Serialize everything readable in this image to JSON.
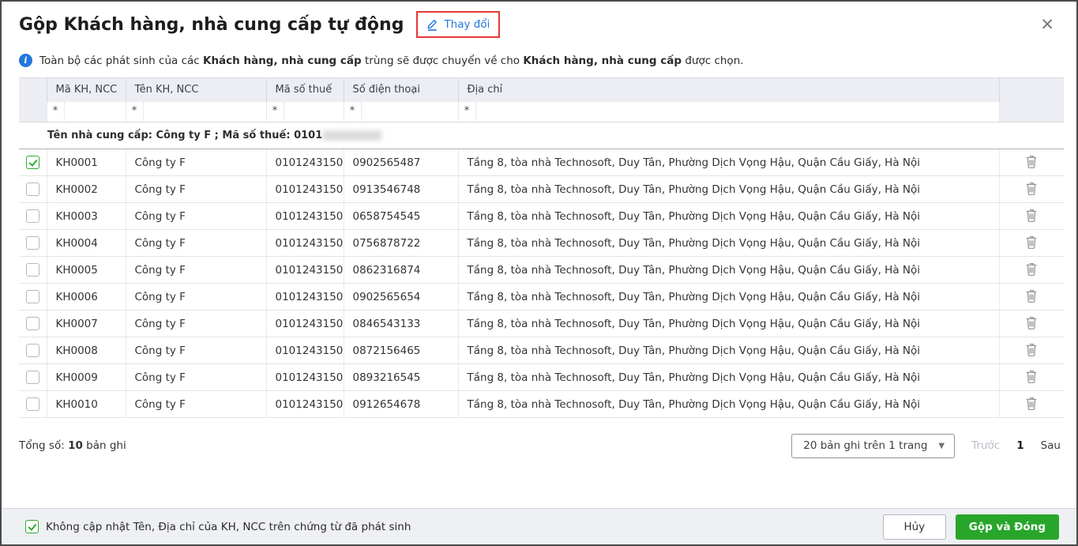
{
  "header": {
    "title": "Gộp Khách hàng, nhà cung cấp tự động",
    "change_button": "Thay đổi",
    "close": "✕"
  },
  "info": {
    "part1": "Toàn bộ các phát sinh của các ",
    "bold1": "Khách hàng, nhà cung cấp",
    "part2": " trùng sẽ được chuyển về cho ",
    "bold2": "Khách hàng, nhà cung cấp",
    "part3": " được chọn."
  },
  "table": {
    "columns": [
      "Mã KH, NCC",
      "Tên KH, NCC",
      "Mã số thuế",
      "Số điện thoại",
      "Địa chỉ"
    ],
    "filter_prefix": "*",
    "group_header": "Tên nhà cung cấp: Công ty F ; Mã số thuế: 0101",
    "rows": [
      {
        "checked": true,
        "code": "KH0001",
        "name": "Công ty F",
        "tax_code": "0101243150",
        "phone": "0902565487",
        "address": "Tầng 8, tòa nhà Technosoft, Duy Tân, Phường Dịch Vọng Hậu, Quận Cầu Giấy, Hà Nội"
      },
      {
        "checked": false,
        "code": "KH0002",
        "name": "Công ty F",
        "tax_code": "0101243150",
        "phone": "0913546748",
        "address": "Tầng 8, tòa nhà Technosoft, Duy Tân, Phường Dịch Vọng Hậu, Quận Cầu Giấy, Hà Nội"
      },
      {
        "checked": false,
        "code": "KH0003",
        "name": "Công ty F",
        "tax_code": "0101243150",
        "phone": "0658754545",
        "address": "Tầng 8, tòa nhà Technosoft, Duy Tân, Phường Dịch Vọng Hậu, Quận Cầu Giấy, Hà Nội"
      },
      {
        "checked": false,
        "code": "KH0004",
        "name": "Công ty F",
        "tax_code": "0101243150",
        "phone": "0756878722",
        "address": "Tầng 8, tòa nhà Technosoft, Duy Tân, Phường Dịch Vọng Hậu, Quận Cầu Giấy, Hà Nội"
      },
      {
        "checked": false,
        "code": "KH0005",
        "name": "Công ty F",
        "tax_code": "0101243150",
        "phone": "0862316874",
        "address": "Tầng 8, tòa nhà Technosoft, Duy Tân, Phường Dịch Vọng Hậu, Quận Cầu Giấy, Hà Nội"
      },
      {
        "checked": false,
        "code": "KH0006",
        "name": "Công ty F",
        "tax_code": "0101243150",
        "phone": "0902565654",
        "address": "Tầng 8, tòa nhà Technosoft, Duy Tân, Phường Dịch Vọng Hậu, Quận Cầu Giấy, Hà Nội"
      },
      {
        "checked": false,
        "code": "KH0007",
        "name": "Công ty F",
        "tax_code": "0101243150",
        "phone": "0846543133",
        "address": "Tầng 8, tòa nhà Technosoft, Duy Tân, Phường Dịch Vọng Hậu, Quận Cầu Giấy, Hà Nội"
      },
      {
        "checked": false,
        "code": "KH0008",
        "name": "Công ty F",
        "tax_code": "0101243150",
        "phone": "0872156465",
        "address": "Tầng 8, tòa nhà Technosoft, Duy Tân, Phường Dịch Vọng Hậu, Quận Cầu Giấy, Hà Nội"
      },
      {
        "checked": false,
        "code": "KH0009",
        "name": "Công ty F",
        "tax_code": "0101243150",
        "phone": "0893216545",
        "address": "Tầng 8, tòa nhà Technosoft, Duy Tân, Phường Dịch Vọng Hậu, Quận Cầu Giấy, Hà Nội"
      },
      {
        "checked": false,
        "code": "KH0010",
        "name": "Công ty F",
        "tax_code": "0101243150",
        "phone": "0912654678",
        "address": "Tầng 8, tòa nhà Technosoft, Duy Tân, Phường Dịch Vọng Hậu, Quận Cầu Giấy, Hà Nội"
      }
    ]
  },
  "footer": {
    "total_label": "Tổng số:",
    "total_value": "10",
    "total_unit": "bản ghi",
    "page_size": "20 bản ghi trên 1 trang",
    "prev": "Trước",
    "current_page": "1",
    "next": "Sau"
  },
  "bottom_bar": {
    "checkbox_label": "Không cập nhật Tên, Địa chỉ của KH, NCC trên chứng từ đã phát sinh",
    "checkbox_checked": true,
    "cancel": "Hủy",
    "confirm": "Gộp và Đóng"
  },
  "colors": {
    "accent_blue": "#2178dd",
    "highlight_red": "#e53935",
    "green": "#28a62b",
    "green_check": "#2dac2d",
    "header_bg": "#eceef4"
  }
}
